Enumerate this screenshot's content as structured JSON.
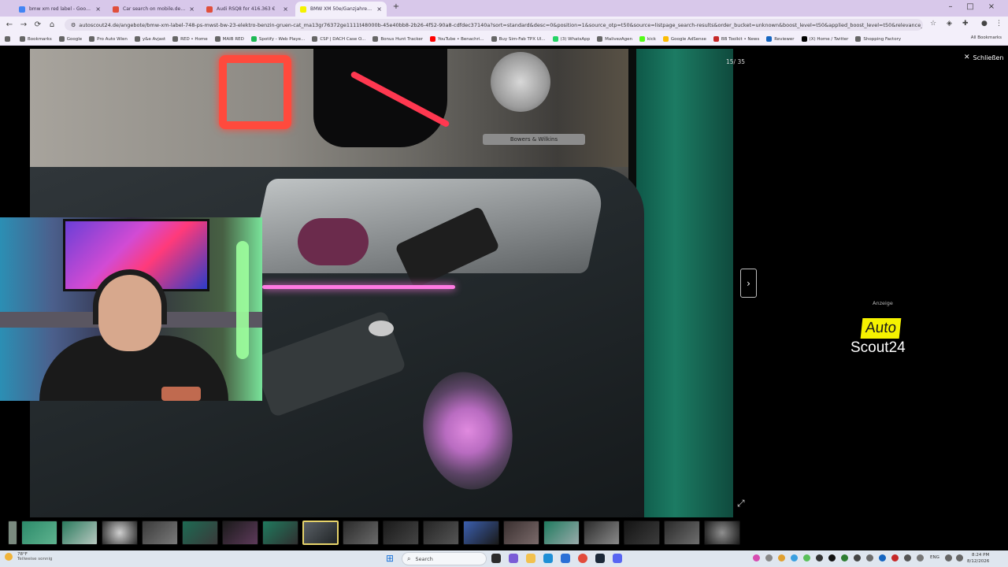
{
  "browser": {
    "tabs": [
      {
        "label": "bmw xm red label - Google",
        "favicon_color": "#4285f4",
        "active": false
      },
      {
        "label": "Car search on mobile.de - Deut",
        "favicon_color": "#e04f3b",
        "active": false
      },
      {
        "label": "Audi RSQ8 for 416.363 €",
        "favicon_color": "#e04f3b",
        "active": false
      },
      {
        "label": "BMW XM 50e/Ganzjahresreifen/",
        "favicon_color": "#f5f200",
        "active": true
      }
    ],
    "new_tab": "+",
    "url": "autoscout24.de/angebote/bmw-xm-label-748-ps-mwst-bw-23-elektro-benzin-gruen-cat_ma13gr76372ge1111t48000b-45e40bb8-2b26-4f52-90a8-cdfdec37140a?sort=standard&desc=0&position=1&source_otp=t50&source=listpage_search-results&order_bucket=unknown&boost_level=t50&applied_boost_level=t50&relevance_adjus...",
    "bookmarks": [
      "Bookmarks",
      "Google",
      "Pro Auto Wien",
      "y&e Avjast",
      "RED • Home",
      "MAIB RED",
      "Spotify - Web Playe...",
      "CSP | DACH Case O...",
      "Bonus Hunt Tracker",
      "YouTube • Benachri...",
      "Buy Sim-Fab TPX Ul...",
      "(3) WhatsApp",
      "MalivezAgen",
      "kick",
      "Google AdSense",
      "BB Toolkit • News",
      "Reviewer",
      "(X) Home / Twitter",
      "Shopping Factory"
    ],
    "all_bookmarks": "All Bookmarks"
  },
  "gallery": {
    "counter": "15/ 35",
    "close_label": "Schließen",
    "next_icon": "›",
    "fullscreen_icon": "⤢",
    "thumbnail_count": 19,
    "selected_thumbnail": 8
  },
  "ad": {
    "label": "Anzeige",
    "logo_line1": "Auto",
    "logo_line2": "Scout24",
    "logo_yellow": "#f5f200"
  },
  "photo": {
    "brand_text": "Bowers & Wilkins"
  },
  "taskbar": {
    "weather_temp": "78°F",
    "weather_desc": "Teilweise sonnig",
    "search_placeholder": "Search",
    "language": "ENG",
    "time": "8:24 PM",
    "date": "8/12/2026"
  }
}
